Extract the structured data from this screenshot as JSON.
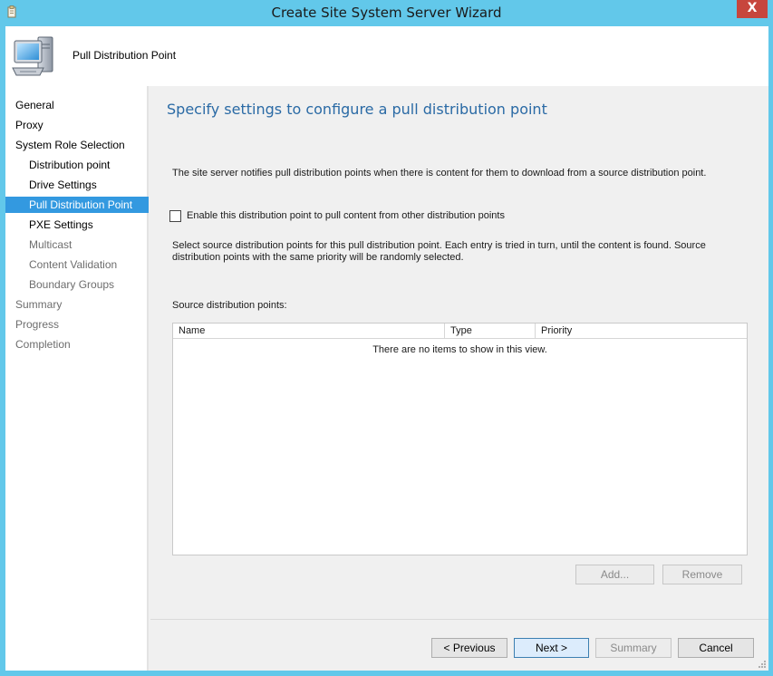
{
  "window": {
    "title": "Create Site System Server Wizard",
    "close_glyph": "X",
    "accent": "#62c8ea"
  },
  "header": {
    "title": "Pull Distribution Point",
    "icon": "computer-icon"
  },
  "sidebar": {
    "items": [
      {
        "label": "General",
        "state": "normal"
      },
      {
        "label": "Proxy",
        "state": "normal"
      },
      {
        "label": "System Role Selection",
        "state": "normal"
      },
      {
        "label": "Distribution point",
        "state": "normal"
      },
      {
        "label": "Drive Settings",
        "state": "normal"
      },
      {
        "label": "Pull Distribution Point",
        "state": "active"
      },
      {
        "label": "PXE Settings",
        "state": "normal"
      },
      {
        "label": "Multicast",
        "state": "dim"
      },
      {
        "label": "Content Validation",
        "state": "dim"
      },
      {
        "label": "Boundary Groups",
        "state": "dim"
      },
      {
        "label": "Summary",
        "state": "dim"
      },
      {
        "label": "Progress",
        "state": "dim"
      },
      {
        "label": "Completion",
        "state": "dim"
      }
    ],
    "active_color": "#3399e0"
  },
  "main": {
    "title": "Specify settings to configure a pull distribution point",
    "description": "The site server notifies pull distribution points when there is content for them to download from a source distribution point.",
    "checkbox_label": "Enable this distribution point to pull content from other distribution points",
    "checkbox_checked": false,
    "select_description": "Select source distribution points for this pull distribution point. Each entry is tried in turn, until the content is found. Source distribution points with the same priority will be randomly selected.",
    "source_label": "Source distribution points:",
    "table": {
      "columns": [
        "Name",
        "Type",
        "Priority"
      ],
      "rows": [],
      "empty_text": "There are no items to show in this view."
    },
    "add_label": "Add...",
    "remove_label": "Remove"
  },
  "footer": {
    "previous_label": "< Previous",
    "next_label": "Next >",
    "summary_label": "Summary",
    "cancel_label": "Cancel"
  }
}
